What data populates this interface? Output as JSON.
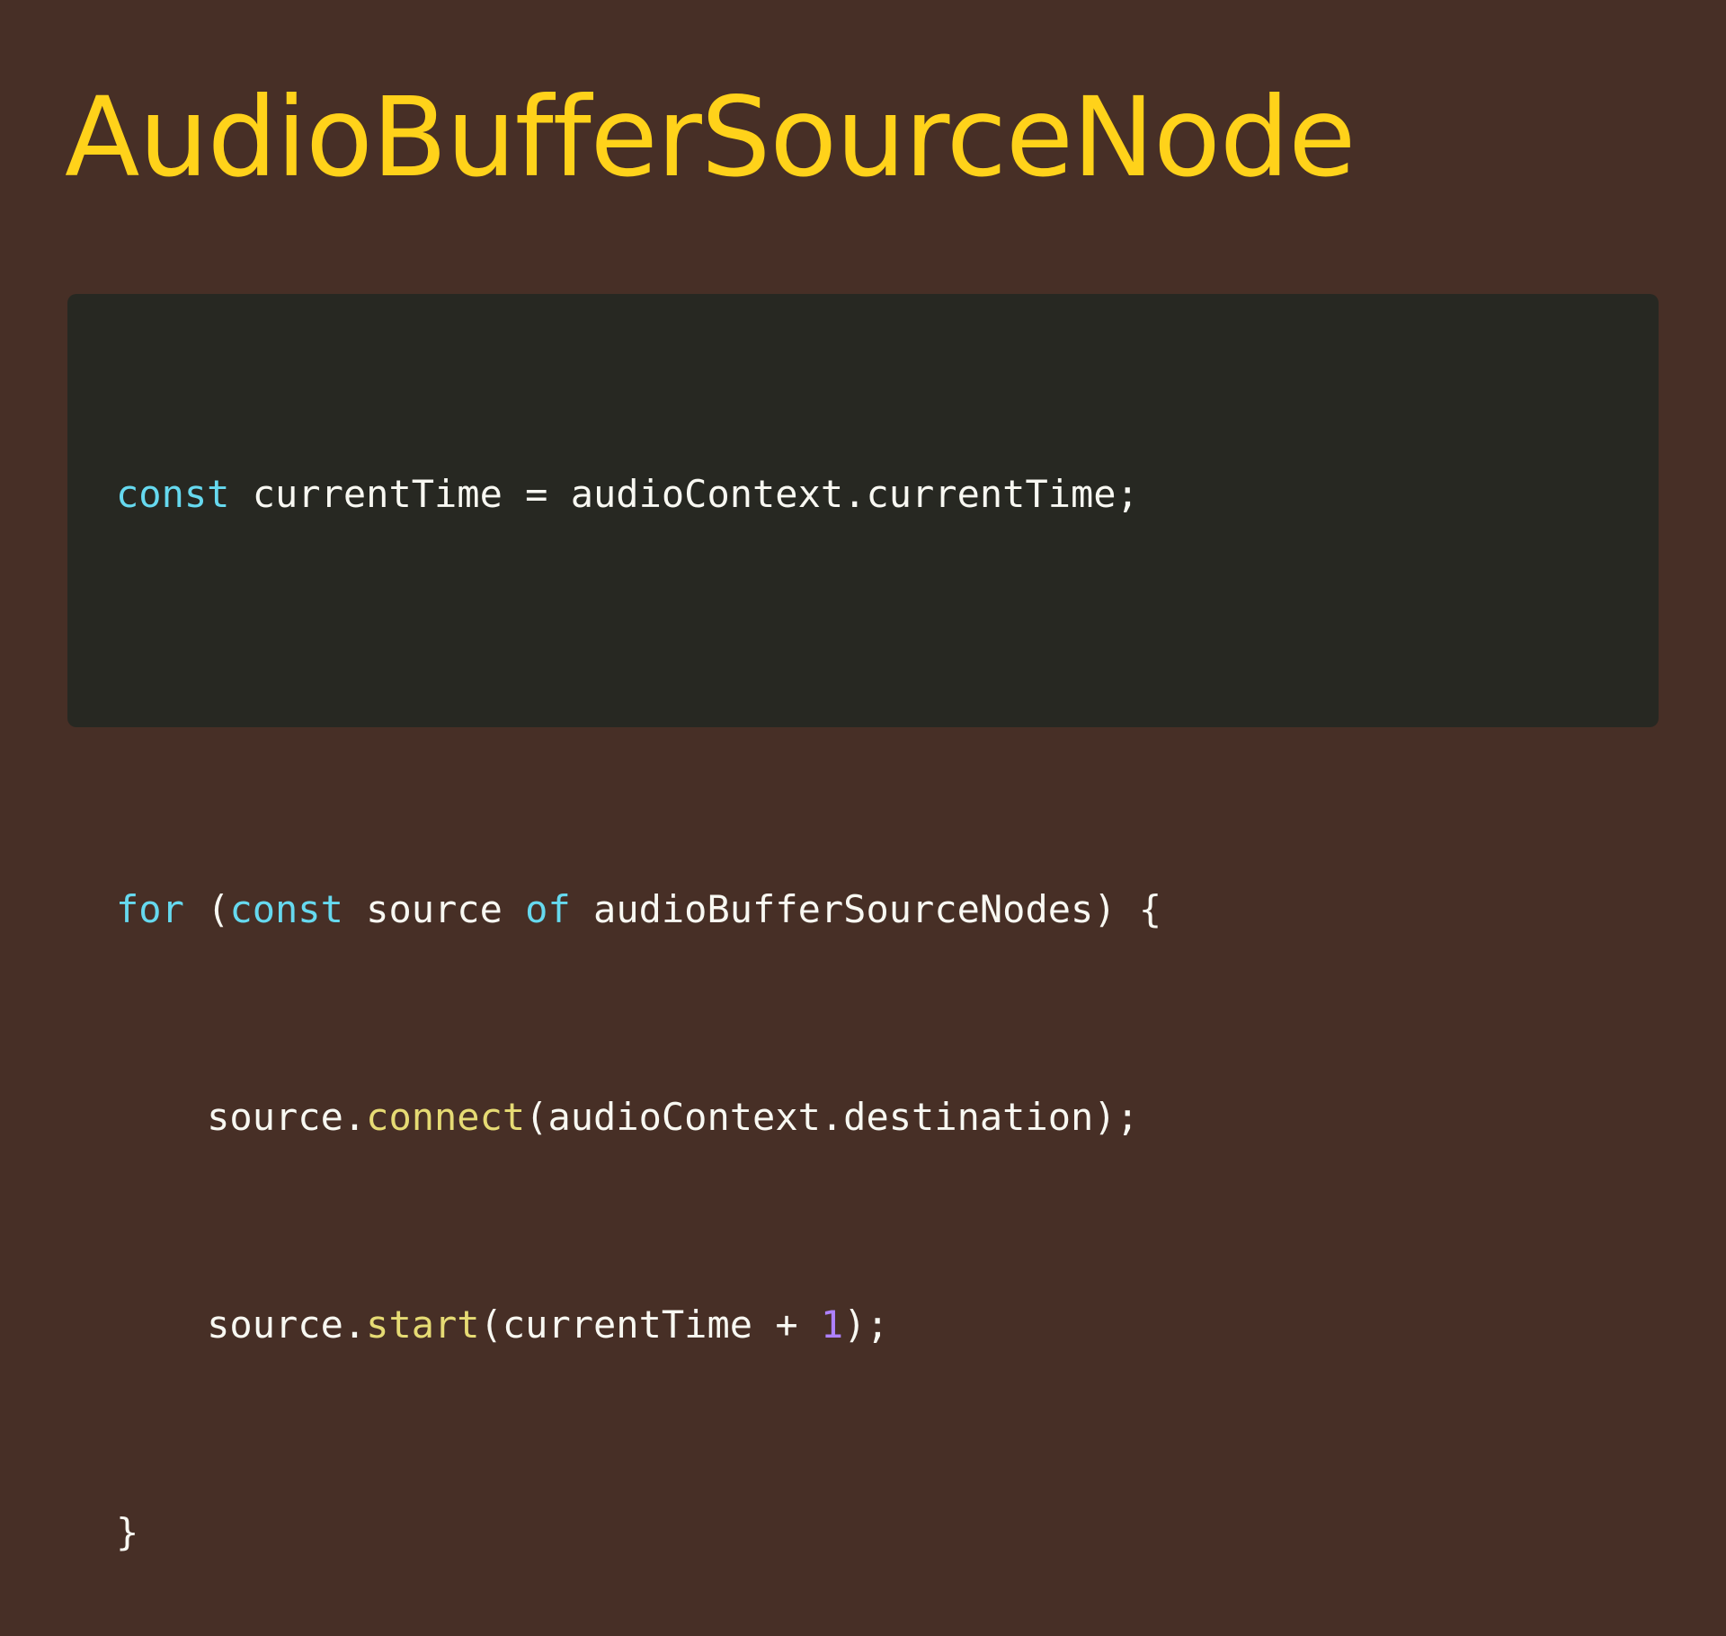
{
  "slide": {
    "title": "AudioBufferSourceNode"
  },
  "colors": {
    "background": "#472f26",
    "title": "#ffd21a",
    "code_background": "#272822",
    "code_text": "#f8f8f2",
    "keyword": "#66d9ef",
    "function": "#e6db74",
    "number": "#ae81ff"
  },
  "code": {
    "language": "javascript",
    "lines": [
      {
        "tokens": [
          {
            "text": "const",
            "kind": "keyword"
          },
          {
            "text": " currentTime = audioContext.currentTime;",
            "kind": "plain"
          }
        ]
      },
      {
        "tokens": []
      },
      {
        "tokens": [
          {
            "text": "for",
            "kind": "keyword"
          },
          {
            "text": " (",
            "kind": "plain"
          },
          {
            "text": "const",
            "kind": "keyword"
          },
          {
            "text": " source ",
            "kind": "plain"
          },
          {
            "text": "of",
            "kind": "keyword"
          },
          {
            "text": " audioBufferSourceNodes) {",
            "kind": "plain"
          }
        ]
      },
      {
        "tokens": [
          {
            "text": "    source.",
            "kind": "plain"
          },
          {
            "text": "connect",
            "kind": "func"
          },
          {
            "text": "(audioContext.destination);",
            "kind": "plain"
          }
        ]
      },
      {
        "tokens": [
          {
            "text": "    source.",
            "kind": "plain"
          },
          {
            "text": "start",
            "kind": "func"
          },
          {
            "text": "(currentTime + ",
            "kind": "plain"
          },
          {
            "text": "1",
            "kind": "number"
          },
          {
            "text": ");",
            "kind": "plain"
          }
        ]
      },
      {
        "tokens": [
          {
            "text": "}",
            "kind": "plain"
          }
        ]
      }
    ]
  }
}
